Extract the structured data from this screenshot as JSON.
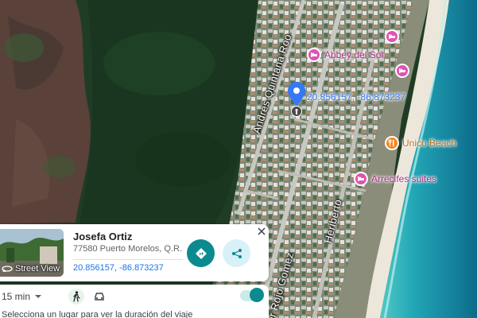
{
  "map": {
    "roads": [
      {
        "id": "andres-quintana-roo",
        "label": "Andres Quintana Roo"
      },
      {
        "id": "heriberto",
        "label": "Heriberto"
      },
      {
        "id": "rojo-gomez",
        "label": "er Rojo Gomez"
      }
    ],
    "pois": [
      {
        "id": "abbey-del-sol",
        "label": "Abbey del Sol",
        "icon": "hotel-icon",
        "color": "#e052b5"
      },
      {
        "id": "unico-beach",
        "label": "Unico Beach",
        "icon": "restaurant-icon",
        "color": "#f08a24"
      },
      {
        "id": "arrecifes-suites",
        "label": "Arrecifes suites",
        "icon": "hotel-icon",
        "color": "#e052b5"
      }
    ],
    "pin": {
      "coords_label": "20.856157, -86.873237",
      "color": "#3478f6"
    }
  },
  "card": {
    "name": "Josefa Ortiz",
    "address": "77580 Puerto Morelos, Q.R.",
    "coords": "20.856157, -86.873237",
    "street_view_label": "Street View",
    "accent": "#0b8a8f"
  },
  "bottom_bar": {
    "time_value": "15 min",
    "hint": "Selecciona un lugar para ver la duración del viaje",
    "toggle_on": true
  }
}
